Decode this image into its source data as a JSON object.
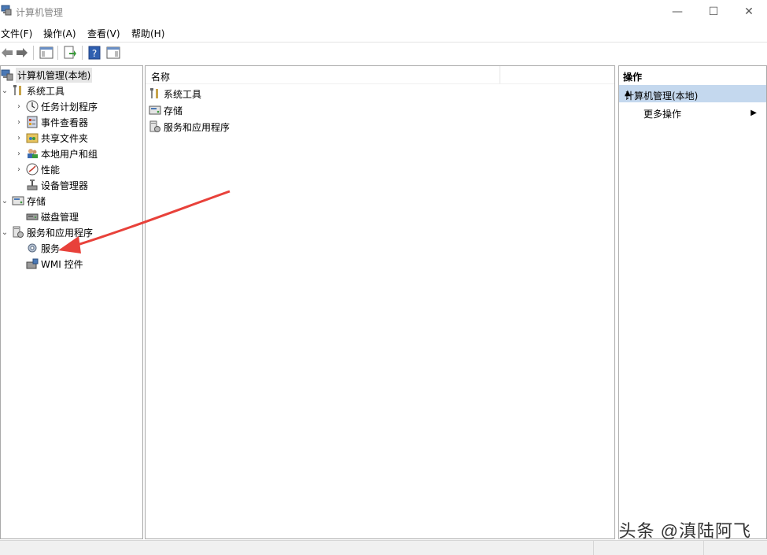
{
  "window": {
    "title": "计算机管理"
  },
  "menu": [
    "文件(F)",
    "操作(A)",
    "查看(V)",
    "帮助(H)"
  ],
  "tree": {
    "root": "计算机管理(本地)",
    "system_tools": "系统工具",
    "task_scheduler": "任务计划程序",
    "event_viewer": "事件查看器",
    "shared_folders": "共享文件夹",
    "local_users": "本地用户和组",
    "performance": "性能",
    "device_manager": "设备管理器",
    "storage": "存储",
    "disk_management": "磁盘管理",
    "services_apps": "服务和应用程序",
    "services": "服务",
    "wmi": "WMI 控件"
  },
  "content": {
    "column_name": "名称",
    "items": [
      "系统工具",
      "存储",
      "服务和应用程序"
    ]
  },
  "actions": {
    "title": "操作",
    "group": "计算机管理(本地)",
    "more": "更多操作"
  },
  "watermark": "头条 @滇陆阿飞",
  "colors": {
    "action_group_bg": "#c4d8ee",
    "arrow": "#e8413a"
  }
}
